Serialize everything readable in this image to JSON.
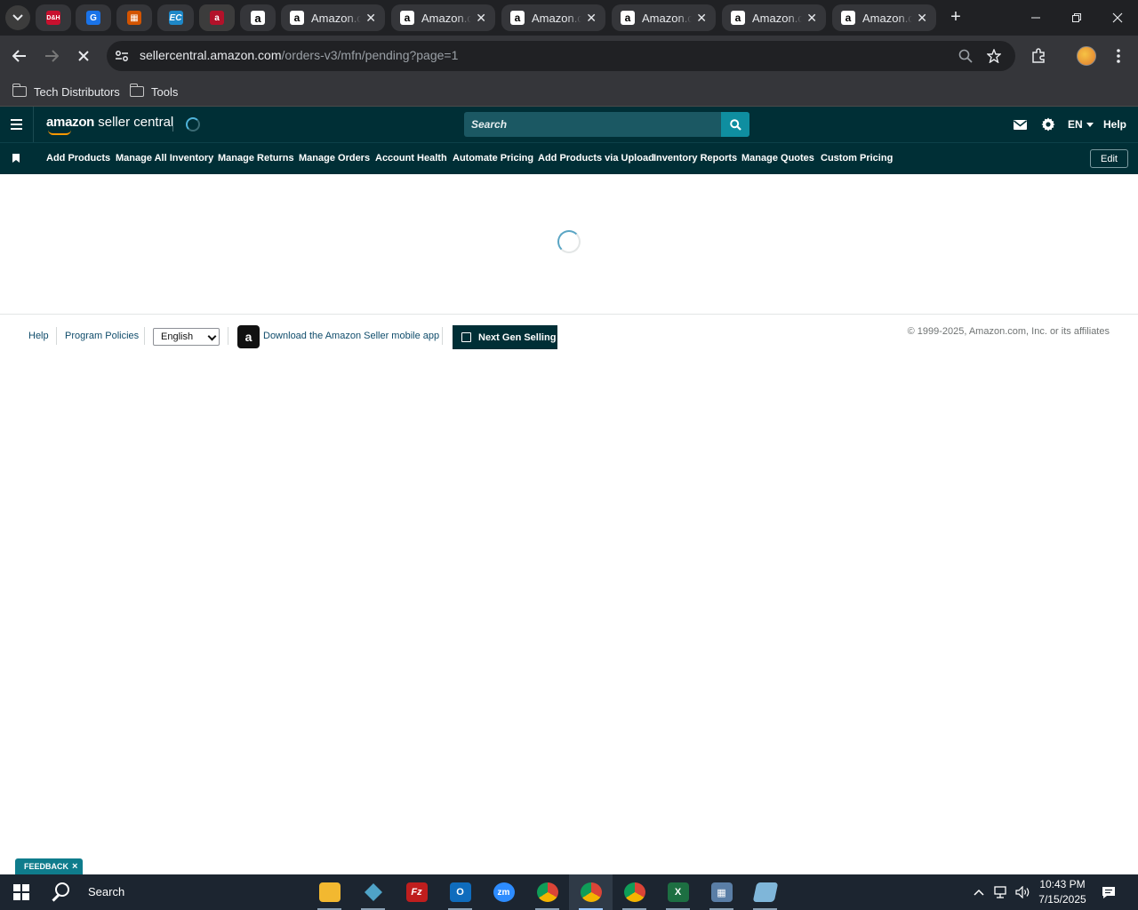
{
  "browser": {
    "tabs": [
      {
        "title": "Amazon.com"
      },
      {
        "title": "Amazon.com"
      },
      {
        "title": "Amazon.com"
      },
      {
        "title": "Amazon.com"
      },
      {
        "title": "Amazon.com"
      },
      {
        "title": "Amazon.com"
      }
    ],
    "pinned_tab_badges": [
      "D&H",
      "G",
      "",
      "EC",
      "a",
      "a"
    ],
    "url_host": "sellercentral.amazon.com",
    "url_path": "/orders-v3/mfn/pending?page=1",
    "bookmarks": [
      "Tech Distributors",
      "Tools"
    ]
  },
  "header": {
    "logo_brand": "amazon",
    "logo_product": " seller central",
    "search_placeholder": "Search",
    "language": "EN",
    "help": "Help"
  },
  "nav": {
    "items": [
      "Add Products",
      "Manage All Inventory",
      "Manage Returns",
      "Manage Orders",
      "Account Health",
      "Automate Pricing",
      "Add Products via Upload",
      "Inventory Reports",
      "Manage Quotes",
      "Custom Pricing"
    ],
    "edit": "Edit"
  },
  "footer": {
    "help": "Help",
    "program_policies": "Program Policies",
    "language_selected": "English",
    "download_app": "Download the Amazon Seller mobile app",
    "next_gen_selling": "Next Gen Selling",
    "copyright": "© 1999-2025, Amazon.com, Inc. or its affiliates"
  },
  "feedback": {
    "label": "FEEDBACK",
    "close": "×"
  },
  "taskbar": {
    "search_label": "Search",
    "time": "10:43 PM",
    "date": "7/15/2025"
  },
  "colors": {
    "seller_central_header": "#002f36",
    "search_button": "#0f8ea0",
    "smile_accent": "#ff9900"
  }
}
